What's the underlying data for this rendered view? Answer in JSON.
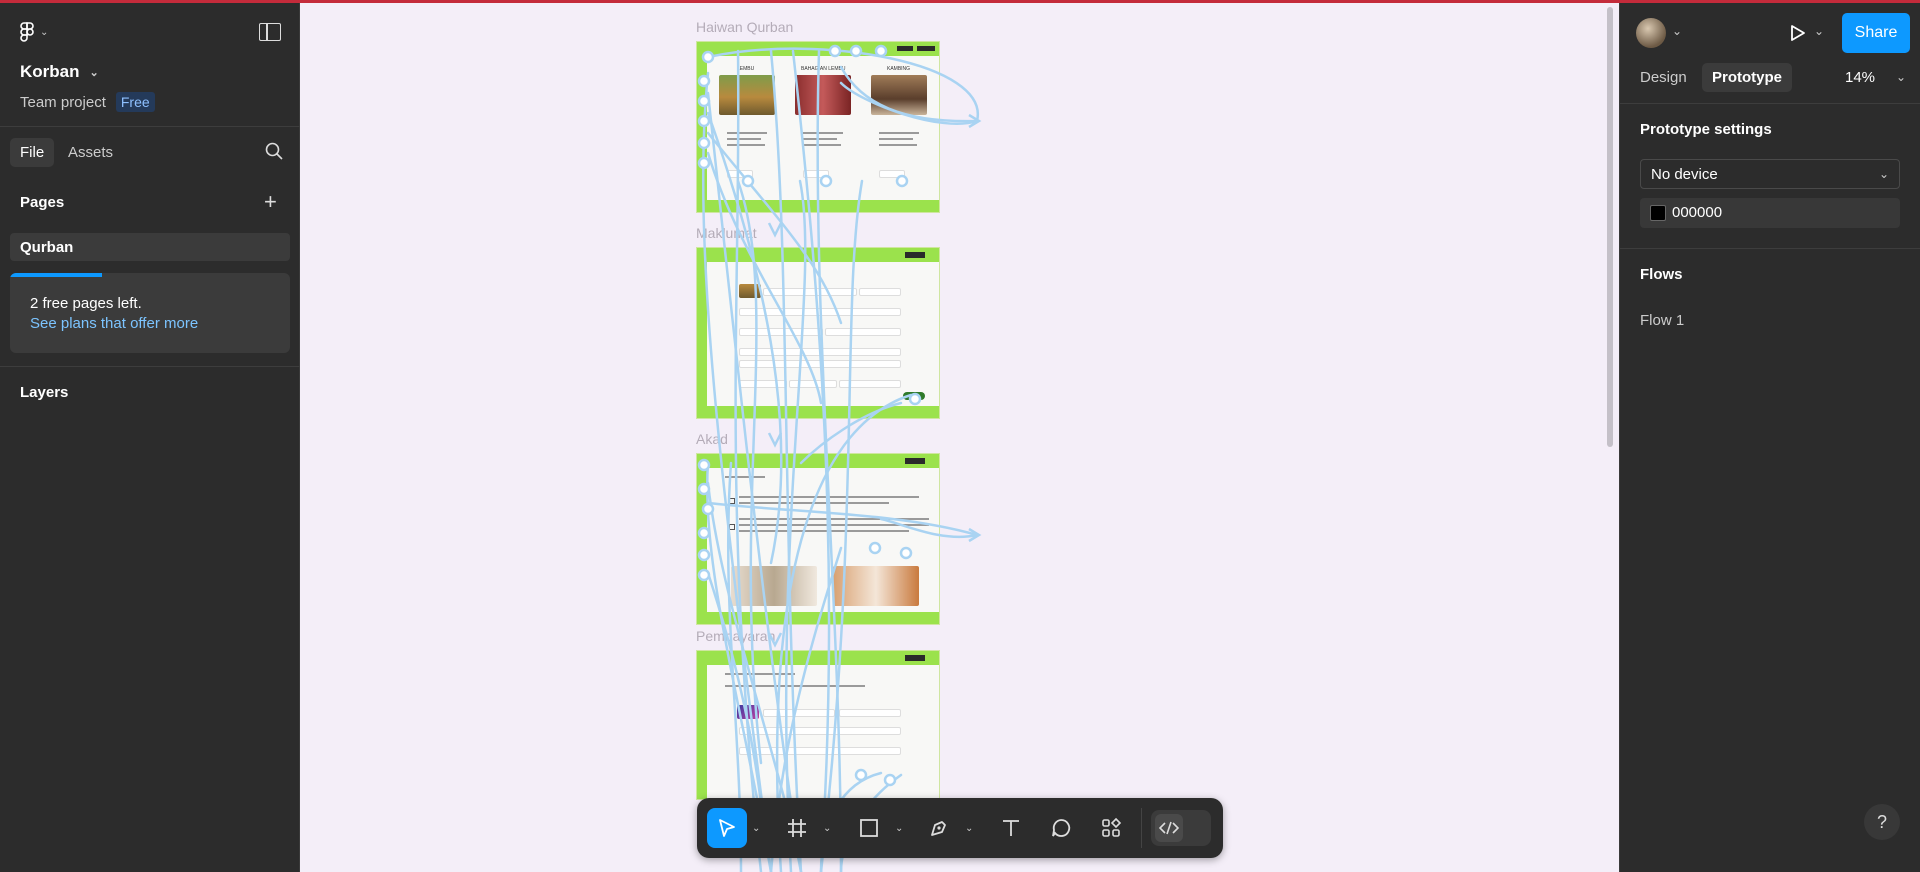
{
  "project": {
    "name": "Korban",
    "team": "Team project",
    "plan_badge": "Free"
  },
  "left_panel": {
    "tabs": [
      "File",
      "Assets"
    ],
    "pages_heading": "Pages",
    "pages": [
      "Qurban"
    ],
    "notice": {
      "line1": "2 free pages left.",
      "link": "See plans that offer more"
    },
    "layers_heading": "Layers"
  },
  "right_panel": {
    "share_label": "Share",
    "tabs": [
      "Design",
      "Prototype"
    ],
    "zoom": "14%",
    "prototype_settings_heading": "Prototype settings",
    "device": "No device",
    "background_color": "000000",
    "flows_heading": "Flows",
    "flows": [
      "Flow 1"
    ]
  },
  "canvas": {
    "frames": [
      {
        "label": "Haiwan Qurban",
        "cards": [
          "LEMBU",
          "BAHAGIAN LEMBU",
          "KAMBING"
        ]
      },
      {
        "label": "Maklumat"
      },
      {
        "label": "Akad"
      },
      {
        "label": "Pembayaran"
      }
    ]
  },
  "toolbar": {
    "tools": [
      "move-tool",
      "frame-tool",
      "rectangle-tool",
      "pen-tool",
      "text-tool",
      "comment-tool",
      "actions-tool",
      "dev-mode-toggle"
    ]
  },
  "colors": {
    "accent": "#0d99ff",
    "frame_green": "#9be24c",
    "flow_line": "#a9d3f2",
    "panel_bg": "#2c2c2c",
    "canvas_bg": "#f4eef8"
  }
}
